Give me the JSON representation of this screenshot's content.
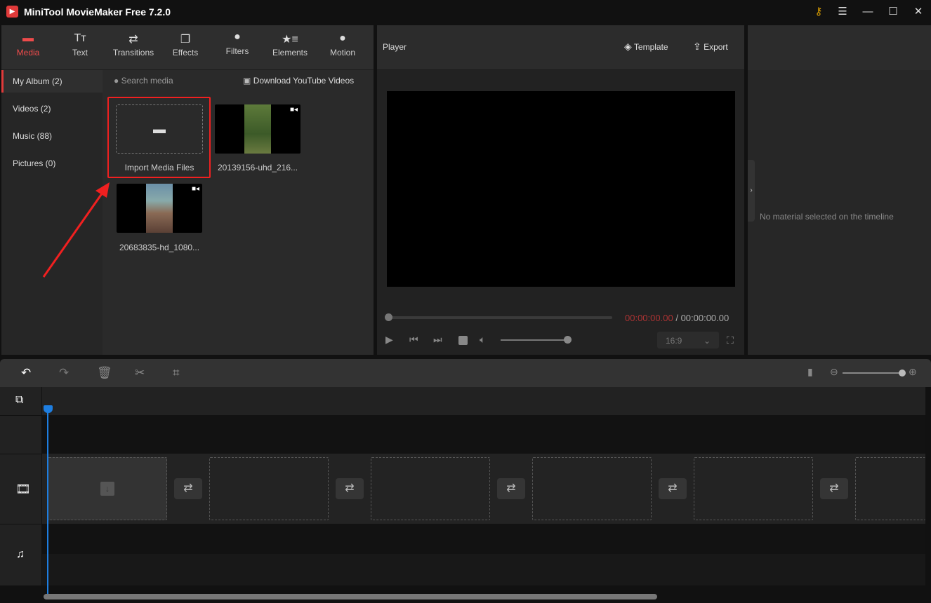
{
  "app": {
    "title": "MiniTool MovieMaker Free 7.2.0",
    "accent": "#e03a3a",
    "playhead_color": "#1e7ee0"
  },
  "tabs": [
    {
      "label": "Media",
      "icon": "folder-icon",
      "active": true
    },
    {
      "label": "Text",
      "icon": "text-icon"
    },
    {
      "label": "Transitions",
      "icon": "transition-icon"
    },
    {
      "label": "Effects",
      "icon": "effects-icon"
    },
    {
      "label": "Filters",
      "icon": "filters-icon"
    },
    {
      "label": "Elements",
      "icon": "elements-icon"
    },
    {
      "label": "Motion",
      "icon": "motion-icon"
    }
  ],
  "sidebar": {
    "items": [
      {
        "label": "My Album (2)",
        "active": true
      },
      {
        "label": "Videos (2)"
      },
      {
        "label": "Music (88)"
      },
      {
        "label": "Pictures (0)"
      }
    ]
  },
  "media": {
    "search_placeholder": "Search media",
    "download_label": "Download YouTube Videos",
    "import_label": "Import Media Files",
    "files": [
      {
        "name": "20139156-uhd_216..."
      },
      {
        "name": "20683835-hd_1080..."
      }
    ]
  },
  "player": {
    "title": "Player",
    "template_label": "Template",
    "export_label": "Export",
    "current_time": "00:00:00.00",
    "separator": "/",
    "total_time": "00:00:00.00",
    "aspect_ratio": "16:9",
    "progress": 0,
    "volume": 1.0
  },
  "properties": {
    "empty_message": "No material selected on the timeline"
  },
  "timeline": {
    "zoom_level": 1.0
  }
}
